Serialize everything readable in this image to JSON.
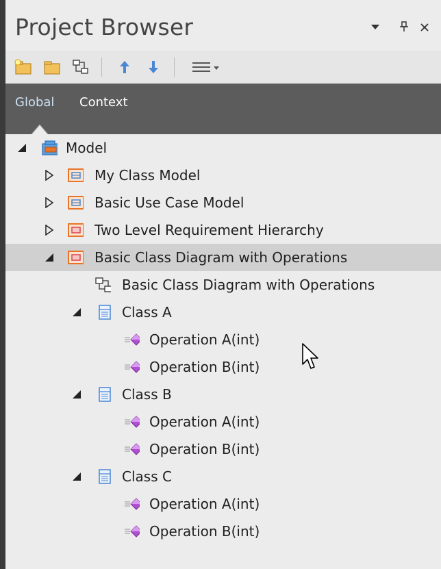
{
  "panel": {
    "title": "Project Browser",
    "dropdown_glyph": "▾",
    "pin_glyph": "ᚹ",
    "close_glyph": "×"
  },
  "toolbar": {
    "buttons": [
      {
        "name": "new-package-icon"
      },
      {
        "name": "open-folder-icon"
      },
      {
        "name": "new-diagram-icon"
      },
      {
        "name": "move-up-icon"
      },
      {
        "name": "move-down-icon"
      },
      {
        "name": "menu-icon"
      }
    ]
  },
  "tabs": {
    "global": "Global",
    "context": "Context"
  },
  "tree": {
    "items": [
      {
        "label": "Model",
        "type": "model",
        "expanded": true
      },
      {
        "label": "My Class Model",
        "type": "package",
        "expanded": false
      },
      {
        "label": "Basic Use Case Model",
        "type": "package",
        "expanded": false
      },
      {
        "label": "Two Level Requirement Hierarchy",
        "type": "package-red",
        "expanded": false
      },
      {
        "label": "Basic Class Diagram with Operations",
        "type": "package-red",
        "expanded": true,
        "selected": true
      },
      {
        "label": "Basic Class Diagram with Operations",
        "type": "diagram"
      },
      {
        "label": "Class A",
        "type": "class",
        "expanded": true
      },
      {
        "label": "Operation A(int)",
        "type": "operation"
      },
      {
        "label": "Operation B(int)",
        "type": "operation"
      },
      {
        "label": "Class B",
        "type": "class",
        "expanded": true
      },
      {
        "label": "Operation A(int)",
        "type": "operation"
      },
      {
        "label": "Operation B(int)",
        "type": "operation"
      },
      {
        "label": "Class C",
        "type": "class",
        "expanded": true
      },
      {
        "label": "Operation A(int)",
        "type": "operation"
      },
      {
        "label": "Operation B(int)",
        "type": "operation"
      }
    ]
  },
  "colors": {
    "tab_bar": "#5c5c5c",
    "selection": "#d0d0d0",
    "accent_blue": "#4a86d4",
    "package_orange": "#e8742a",
    "operation_purple": "#b04fd0"
  }
}
